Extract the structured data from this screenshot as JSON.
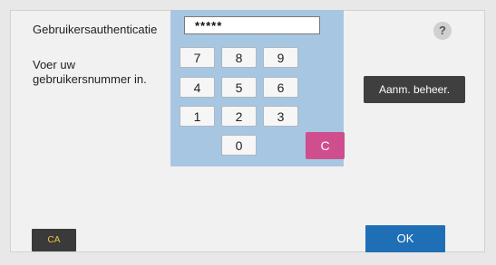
{
  "title": "Gebruikersauthenticatie",
  "instruction": "Voer uw gebruikersnummer in.",
  "pin_value": "*****",
  "keys": [
    "7",
    "8",
    "9",
    "4",
    "5",
    "6",
    "1",
    "2",
    "3",
    "0"
  ],
  "clear_label": "C",
  "help_label": "?",
  "admin_button": "Aanm. beheer.",
  "ca_button": "CA",
  "ok_button": "OK",
  "colors": {
    "keypad_bg": "#a7c6e2",
    "clear_key": "#cf4f8e",
    "ok_button": "#1f6fb7",
    "ca_text": "#f2c542"
  }
}
